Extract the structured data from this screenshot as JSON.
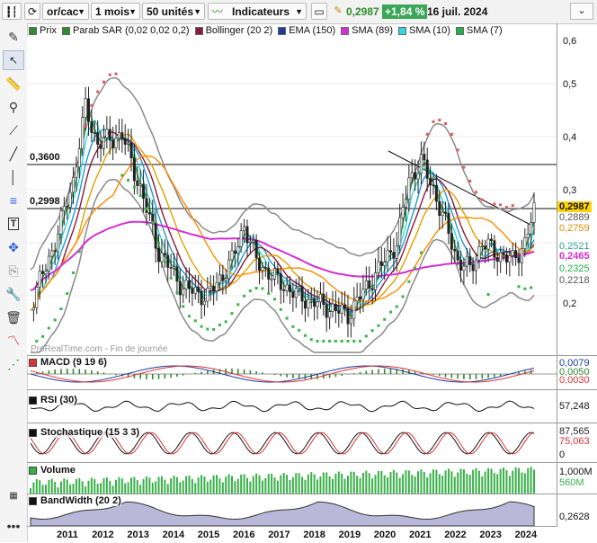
{
  "toolbar": {
    "ticker": "or/cac",
    "period": "1 mois",
    "units": "50 unités",
    "indicators_label": "Indicateurs",
    "price": "0,2987",
    "change": "+1,84 %",
    "date": "16 juil. 2024",
    "icons": [
      "bar-chart-icon",
      "refresh-icon",
      "indicator-icon",
      "window-icon",
      "edit-icon"
    ]
  },
  "legend": [
    {
      "label": "Prix",
      "color": "#2e8b2e"
    },
    {
      "label": "Parab SAR (0,02 0,02 0,2)",
      "color": "#2e8b2e"
    },
    {
      "label": "Bollinger (20 2)",
      "color": "#8b1a3a"
    },
    {
      "label": "EMA (150)",
      "color": "#1f3a9e"
    },
    {
      "label": "SMA (89)",
      "color": "#d42fd4"
    },
    {
      "label": "SMA (10)",
      "color": "#33d6e0"
    },
    {
      "label": "SMA (7)",
      "color": "#22b04a"
    }
  ],
  "price_axis": [
    "0,6",
    "0,5",
    "0,4",
    "0,3",
    "0,2"
  ],
  "price_tags": [
    {
      "text": "0,2987",
      "bg": "#ffd400",
      "color": "#000"
    },
    {
      "text": "0,2889",
      "bg": "#ffffff",
      "color": "#555"
    },
    {
      "text": "0,2759",
      "bg": "#ffffff",
      "color": "#e08a00"
    },
    {
      "text": "0,2521",
      "bg": "#ffffff",
      "color": "#2aa0a0"
    },
    {
      "text": "0,2465",
      "bg": "#ffffff",
      "color": "#d42fd4"
    },
    {
      "text": "0,2325",
      "bg": "#ffffff",
      "color": "#22b04a"
    },
    {
      "text": "0,2218",
      "bg": "#ffffff",
      "color": "#555"
    }
  ],
  "hlines": [
    {
      "label": "0,3600"
    },
    {
      "label": "0,2998"
    }
  ],
  "watermark": "ProRealTime.com - Fin de journée",
  "panels": {
    "macd": {
      "label": "MACD (9 19 6)",
      "tags": [
        "0,0079",
        "0,0050",
        "0,0030"
      ]
    },
    "rsi": {
      "label": "RSI (30)",
      "tags": [
        "57,248"
      ]
    },
    "stoch": {
      "label": "Stochastique (15 3 3)",
      "tags": [
        "87,565",
        "75,063",
        "0"
      ]
    },
    "volume": {
      "label": "Volume",
      "tags": [
        "1,000M",
        "560M"
      ]
    },
    "bandwidth": {
      "label": "BandWidth (20 2)",
      "tags": [
        "0,2628"
      ]
    }
  },
  "years": [
    "2011",
    "2012",
    "2013",
    "2014",
    "2015",
    "2016",
    "2017",
    "2018",
    "2019",
    "2020",
    "2021",
    "2022",
    "2023",
    "2024"
  ],
  "colors": {
    "accent": "#3aa657",
    "sar": "#e05a5a",
    "sar_low": "#39b54a",
    "bollinger": "#888888",
    "volume": "#38b048",
    "bandwidth": "#b9b8d8"
  }
}
